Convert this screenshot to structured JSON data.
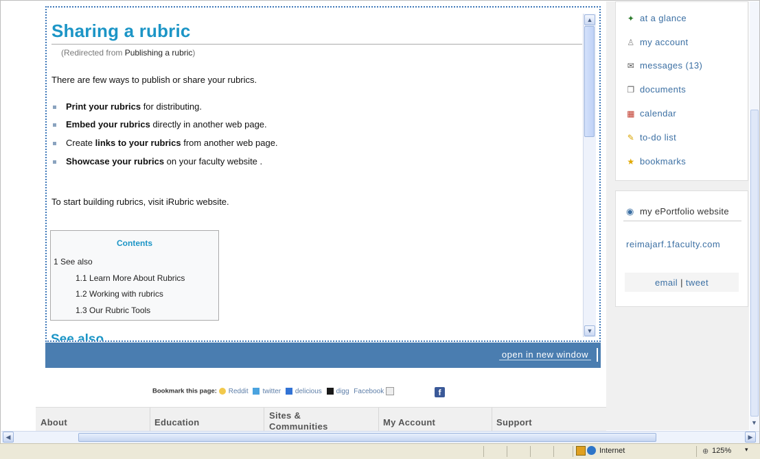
{
  "article": {
    "title": "Sharing a rubric",
    "redirect_prefix": "(Redirected from ",
    "redirect_link": "Publishing a rubric",
    "redirect_suffix": ")",
    "intro": "There are few ways to publish or share your rubrics.",
    "bullets": [
      {
        "bold": "Print your rubrics",
        "rest": " for distributing."
      },
      {
        "bold": "Embed your rubrics",
        "rest": " directly in another web page."
      },
      {
        "pre": "Create ",
        "bold": "links to your rubrics",
        "rest": " from another web page."
      },
      {
        "bold": "Showcase your rubrics",
        "rest": " on your faculty website ."
      }
    ],
    "cta": "To start building rubrics, visit iRubric website.",
    "toc": {
      "title": "Contents",
      "items": [
        "1 See also",
        "1.1 Learn More About Rubrics",
        "1.2 Working with rubrics",
        "1.3 Our Rubric Tools"
      ]
    },
    "see_also": "See also"
  },
  "open_new_window": "open in new window",
  "bookmark_bar": {
    "label": "Bookmark this page:",
    "links": [
      "Reddit",
      "twitter",
      "delicious",
      "digg",
      "Facebook"
    ]
  },
  "footer": [
    "About",
    "Education",
    "Sites & Communities",
    "My Account",
    "Support"
  ],
  "sidebar": {
    "menu": [
      {
        "icon": "at-a-glance-icon",
        "glyph": "✦",
        "color": "#2b7a2b",
        "label": "at a glance"
      },
      {
        "icon": "user-icon",
        "glyph": "♙",
        "color": "#888",
        "label": "my account"
      },
      {
        "icon": "messages-icon",
        "glyph": "✉",
        "color": "#555",
        "label": "messages (13)"
      },
      {
        "icon": "documents-icon",
        "glyph": "❐",
        "color": "#666",
        "label": "documents"
      },
      {
        "icon": "calendar-icon",
        "glyph": "▦",
        "color": "#c0392b",
        "label": "calendar"
      },
      {
        "icon": "todo-icon",
        "glyph": "✎",
        "color": "#d9a400",
        "label": "to-do list"
      },
      {
        "icon": "bookmarks-icon",
        "glyph": "★",
        "color": "#e0a800",
        "label": "bookmarks"
      }
    ],
    "eportfolio_title": "my ePortfolio website",
    "site": "reimajarf.1faculty.com",
    "share_email": "email",
    "share_sep": " | ",
    "share_tweet": "tweet"
  },
  "status": {
    "zone": "Internet",
    "zoom": "125%"
  }
}
